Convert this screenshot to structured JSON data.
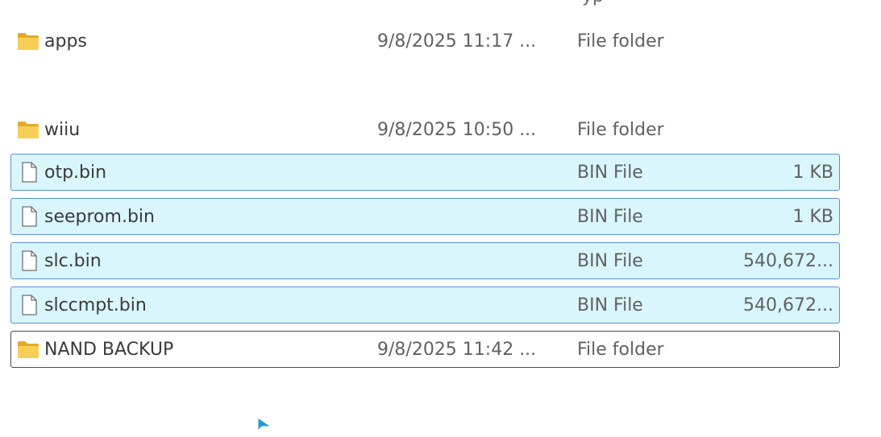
{
  "header": {
    "type_column_fragment": "yp"
  },
  "files": [
    {
      "name": "apps",
      "date_modified": "9/8/2025 11:17 ...",
      "type": "File folder",
      "size": "",
      "icon": "folder-icon",
      "state": "normal"
    },
    {
      "name": "wiiu",
      "date_modified": "9/8/2025 10:50 ...",
      "type": "File folder",
      "size": "",
      "icon": "folder-icon",
      "state": "normal"
    },
    {
      "name": "otp.bin",
      "date_modified": "",
      "type": "BIN File",
      "size": "1 KB",
      "icon": "file-icon",
      "state": "selected"
    },
    {
      "name": "seeprom.bin",
      "date_modified": "",
      "type": "BIN File",
      "size": "1 KB",
      "icon": "file-icon",
      "state": "selected"
    },
    {
      "name": "slc.bin",
      "date_modified": "",
      "type": "BIN File",
      "size": "540,672...",
      "icon": "file-icon",
      "state": "selected"
    },
    {
      "name": "slccmpt.bin",
      "date_modified": "",
      "type": "BIN File",
      "size": "540,672...",
      "icon": "file-icon",
      "state": "selected"
    },
    {
      "name": "NAND BACKUP",
      "date_modified": "9/8/2025 11:42 ...",
      "type": "File folder",
      "size": "",
      "icon": "folder-icon",
      "state": "focused"
    }
  ],
  "colors": {
    "selection_fill": "#d9f6fc",
    "selection_border": "#5a8fd6",
    "focus_border": "#4a4a4a",
    "folder": "#f3c44a",
    "cursor": "#1e9ad6"
  }
}
